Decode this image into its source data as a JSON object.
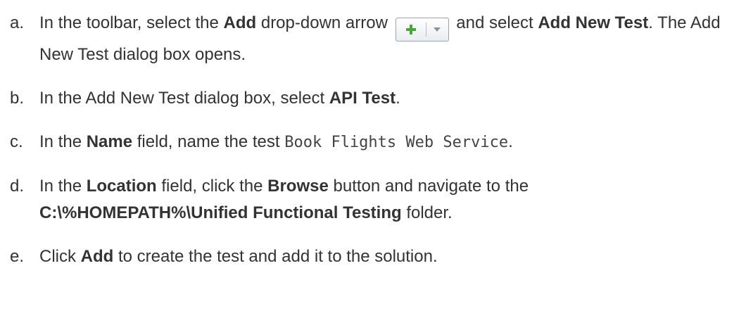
{
  "steps": [
    {
      "letter": "a.",
      "t1": "In the toolbar, select the ",
      "b1": "Add",
      "t2": " drop-down arrow ",
      "t3": " and select ",
      "b2": "Add New Test",
      "t4": ". The Add New Test dialog box opens."
    },
    {
      "letter": "b.",
      "t1": "In the Add New Test dialog box, select ",
      "b1": "API Test",
      "t2": "."
    },
    {
      "letter": "c.",
      "t1": "In the ",
      "b1": "Name",
      "t2": " field, name the test ",
      "code": "Book Flights Web Service",
      "t3": "."
    },
    {
      "letter": "d.",
      "t1": "In the ",
      "b1": "Location",
      "t2": " field, click the ",
      "b2": "Browse",
      "t3": " button and navigate to the ",
      "b3": "C:\\%HOMEPATH%\\Unified Functional Testing",
      "t4": " folder."
    },
    {
      "letter": "e.",
      "t1": "Click ",
      "b1": "Add",
      "t2": " to create the test and add it to the solution."
    }
  ],
  "icons": {
    "add_button": "plus-icon",
    "dropdown": "chevron-down-icon",
    "plus_color": "#4aa63c"
  }
}
